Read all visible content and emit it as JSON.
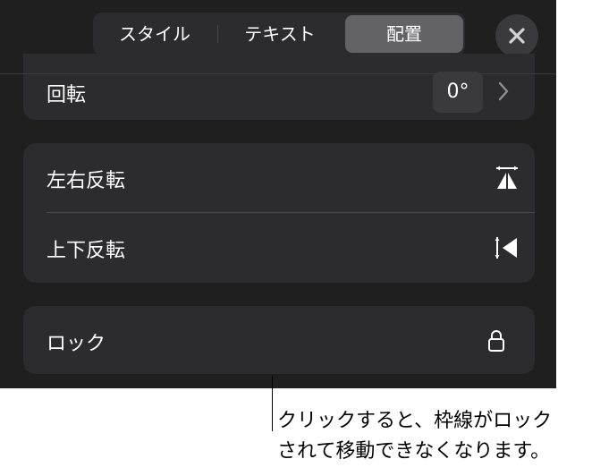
{
  "tabs": {
    "style": "スタイル",
    "text": "テキスト",
    "arrange": "配置"
  },
  "rotate": {
    "label": "回転",
    "value": "0°"
  },
  "flip": {
    "horizontal_label": "左右反転",
    "vertical_label": "上下反転"
  },
  "lock": {
    "label": "ロック"
  },
  "callout": {
    "line1": "クリックすると、枠線がロック",
    "line2": "されて移動できなくなります。"
  },
  "icons": {
    "close": "close-icon",
    "chevron": "chevron-right-icon",
    "flip_horizontal": "flip-horizontal-icon",
    "flip_vertical": "flip-vertical-icon",
    "lock": "lock-icon"
  },
  "colors": {
    "panel_bg": "#1f1f1f",
    "card_bg": "#2c2c2e",
    "selected_tab": "#636366"
  }
}
